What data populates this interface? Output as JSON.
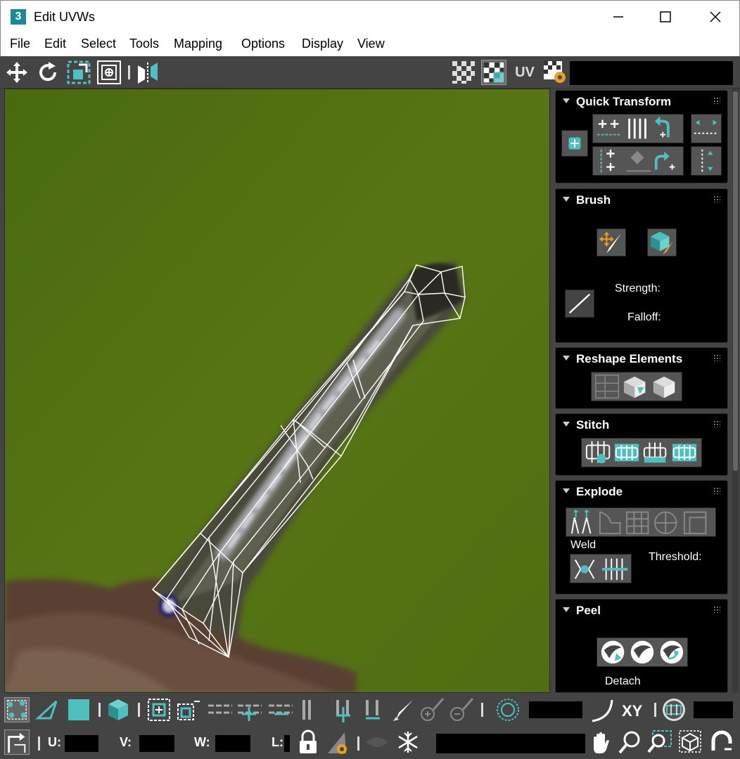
{
  "window": {
    "app_icon_text": "3",
    "title": "Edit UVWs"
  },
  "menu": [
    "File",
    "Edit",
    "Select",
    "Tools",
    "Mapping",
    "Options",
    "Display",
    "View"
  ],
  "toolbar": {
    "uv_label": "UV"
  },
  "panel": {
    "quick_transform": {
      "title": "Quick Transform"
    },
    "brush": {
      "title": "Brush",
      "strength_label": "Strength:",
      "falloff_label": "Falloff:"
    },
    "reshape": {
      "title": "Reshape Elements"
    },
    "stitch": {
      "title": "Stitch"
    },
    "explode": {
      "title": "Explode",
      "weld_label": "Weld",
      "threshold_label": "Threshold:"
    },
    "peel": {
      "title": "Peel",
      "detach_label": "Detach"
    }
  },
  "bottom": {
    "xy_label": "XY",
    "u_label": "U:",
    "v_label": "V:",
    "w_label": "W:",
    "l_label": "L:"
  },
  "colors": {
    "accent": "#4fbfbf",
    "viewport_bg": "#527012",
    "wireframe": "#ffffff"
  }
}
